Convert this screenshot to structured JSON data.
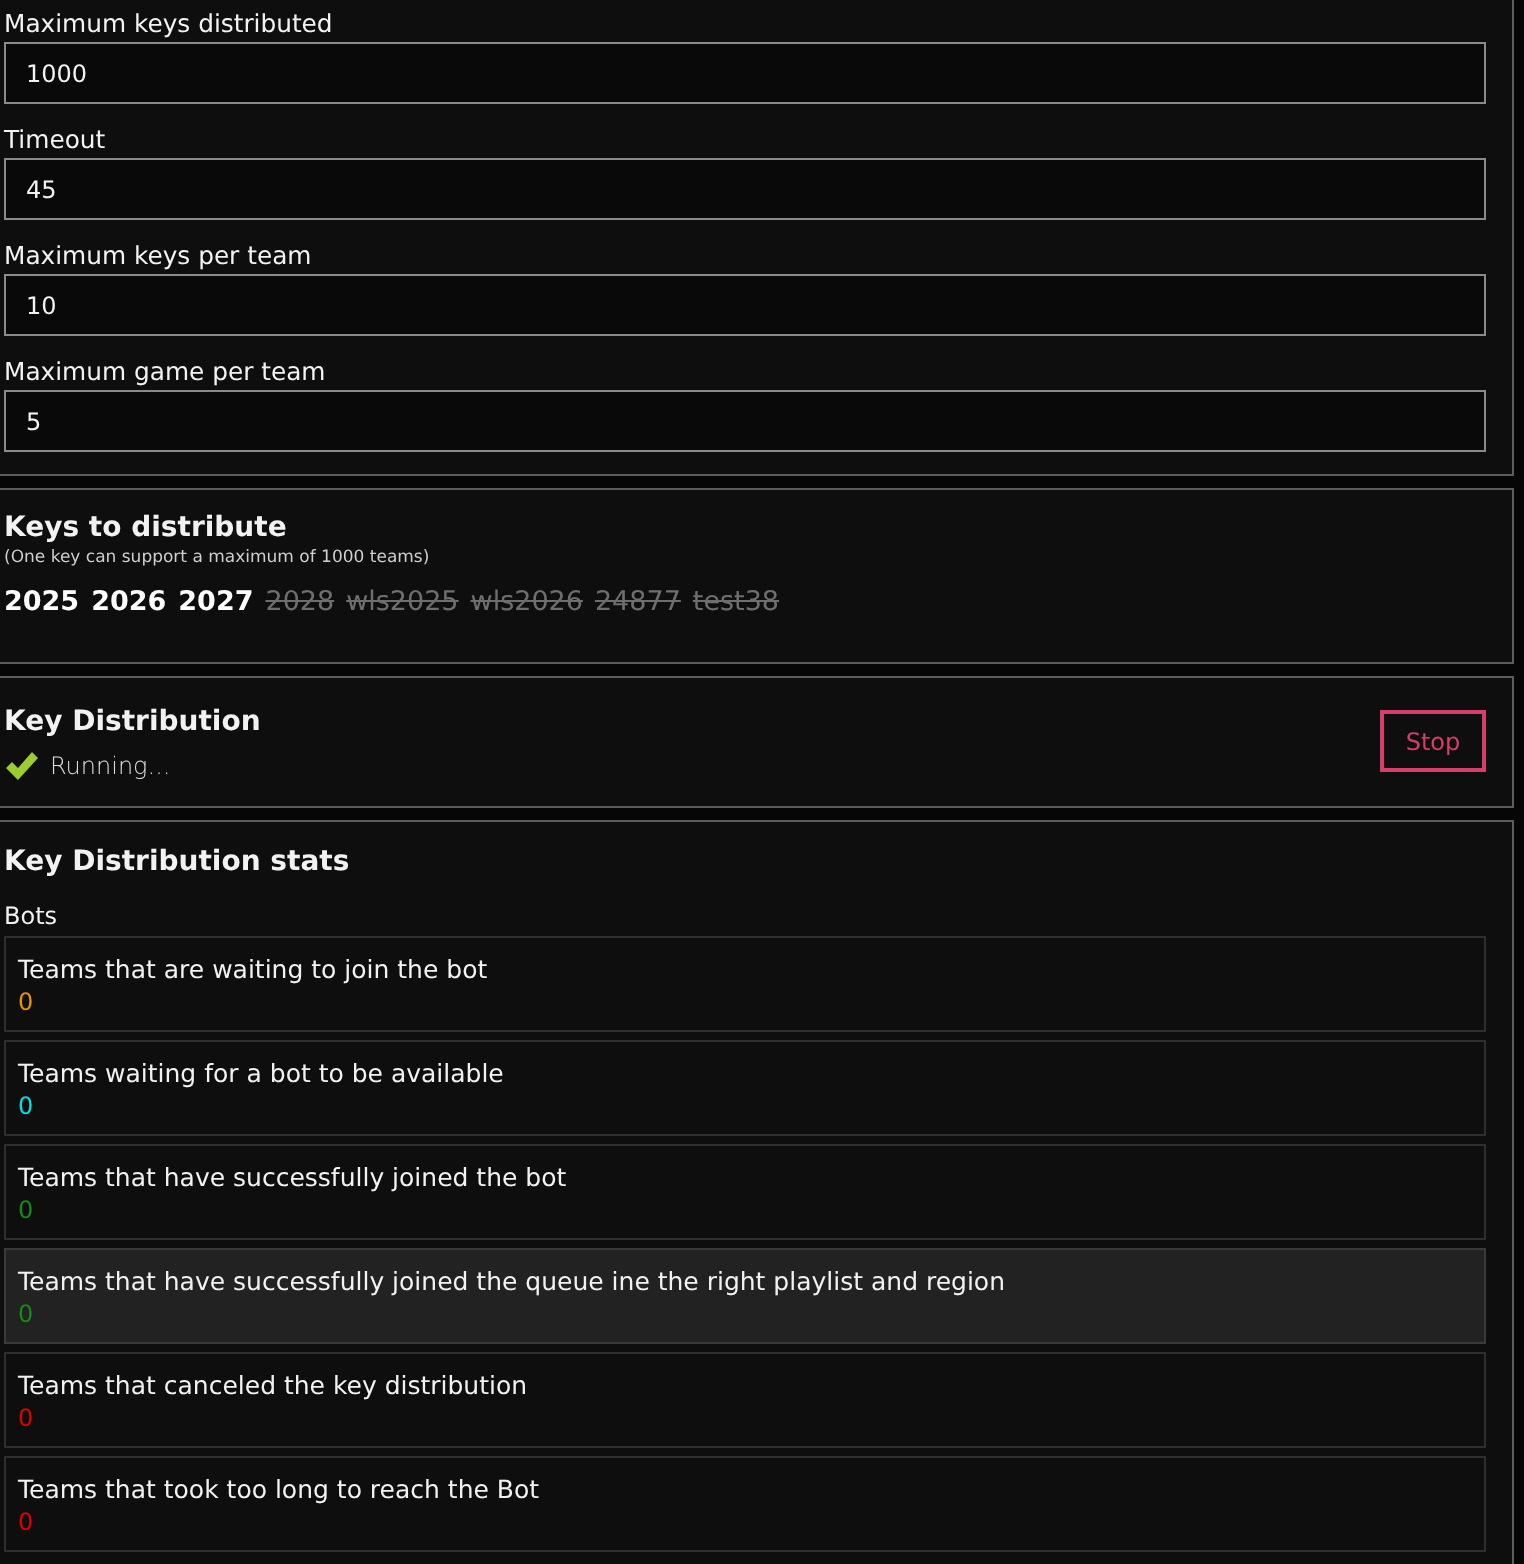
{
  "settings": {
    "fields": [
      {
        "label": "Maximum keys distributed",
        "value": "1000"
      },
      {
        "label": "Timeout",
        "value": "45"
      },
      {
        "label": "Maximum keys per team",
        "value": "10"
      },
      {
        "label": "Maximum game per team",
        "value": "5"
      }
    ]
  },
  "keys": {
    "title": "Keys to distribute",
    "note": "(One key can support a maximum of 1000 teams)",
    "items": [
      {
        "label": "2025",
        "enabled": true
      },
      {
        "label": "2026",
        "enabled": true
      },
      {
        "label": "2027",
        "enabled": true
      },
      {
        "label": "2028",
        "enabled": false
      },
      {
        "label": "wls2025",
        "enabled": false
      },
      {
        "label": "wls2026",
        "enabled": false
      },
      {
        "label": "24877",
        "enabled": false
      },
      {
        "label": "test38",
        "enabled": false
      }
    ]
  },
  "distribution": {
    "title": "Key Distribution",
    "status": {
      "kind": "running",
      "text": "Running..."
    },
    "button": "Stop"
  },
  "stats": {
    "title": "Key Distribution stats",
    "group": "Bots",
    "items": [
      {
        "label": "Teams that are waiting to join the bot",
        "value": "0",
        "color": "#e69500",
        "highlighted": false
      },
      {
        "label": "Teams waiting for a bot to be available",
        "value": "0",
        "color": "#00e0e0",
        "highlighted": false
      },
      {
        "label": "Teams that have successfully joined the bot",
        "value": "0",
        "color": "#168a16",
        "highlighted": false
      },
      {
        "label": "Teams that have successfully joined the queue ine the right playlist and region",
        "value": "0",
        "color": "#168a16",
        "highlighted": true
      },
      {
        "label": "Teams that canceled the key distribution",
        "value": "0",
        "color": "#e00000",
        "highlighted": false
      },
      {
        "label": "Teams that took too long to reach the Bot",
        "value": "0",
        "color": "#e00000",
        "highlighted": false
      }
    ]
  }
}
